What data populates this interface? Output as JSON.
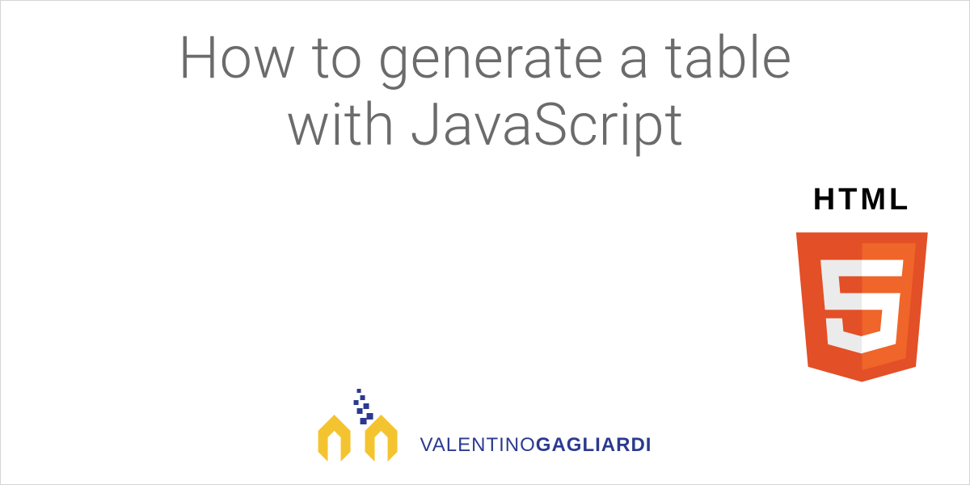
{
  "title": "How to generate a table with JavaScript",
  "html5_label": "HTML",
  "author": {
    "first": "VALENTINO",
    "last": "GAGLIARDI"
  }
}
